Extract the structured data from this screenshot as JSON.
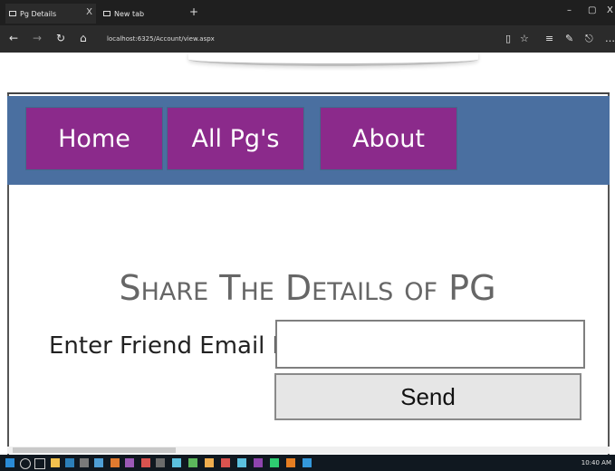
{
  "browser": {
    "tabs": [
      {
        "title": "Pg Details",
        "active": true
      },
      {
        "title": "New tab",
        "active": false
      }
    ],
    "url": "localhost:6325/Account/view.aspx",
    "tab_close_glyph": "X",
    "new_tab_glyph": "+",
    "window_controls": [
      "–",
      "▢",
      "X"
    ]
  },
  "menu": {
    "home": "Home",
    "all_pgs": "All Pg's",
    "about": "About"
  },
  "main": {
    "title": "Share The Details of PG",
    "email_label": "Enter Friend Email ID:",
    "email_value": "",
    "send_label": "Send"
  },
  "taskbar": {
    "time": "10:40 AM"
  },
  "colors": {
    "menubar_bg": "#4a6fa0",
    "menu_item_bg": "#8b2a8b",
    "title_color": "#666666"
  }
}
